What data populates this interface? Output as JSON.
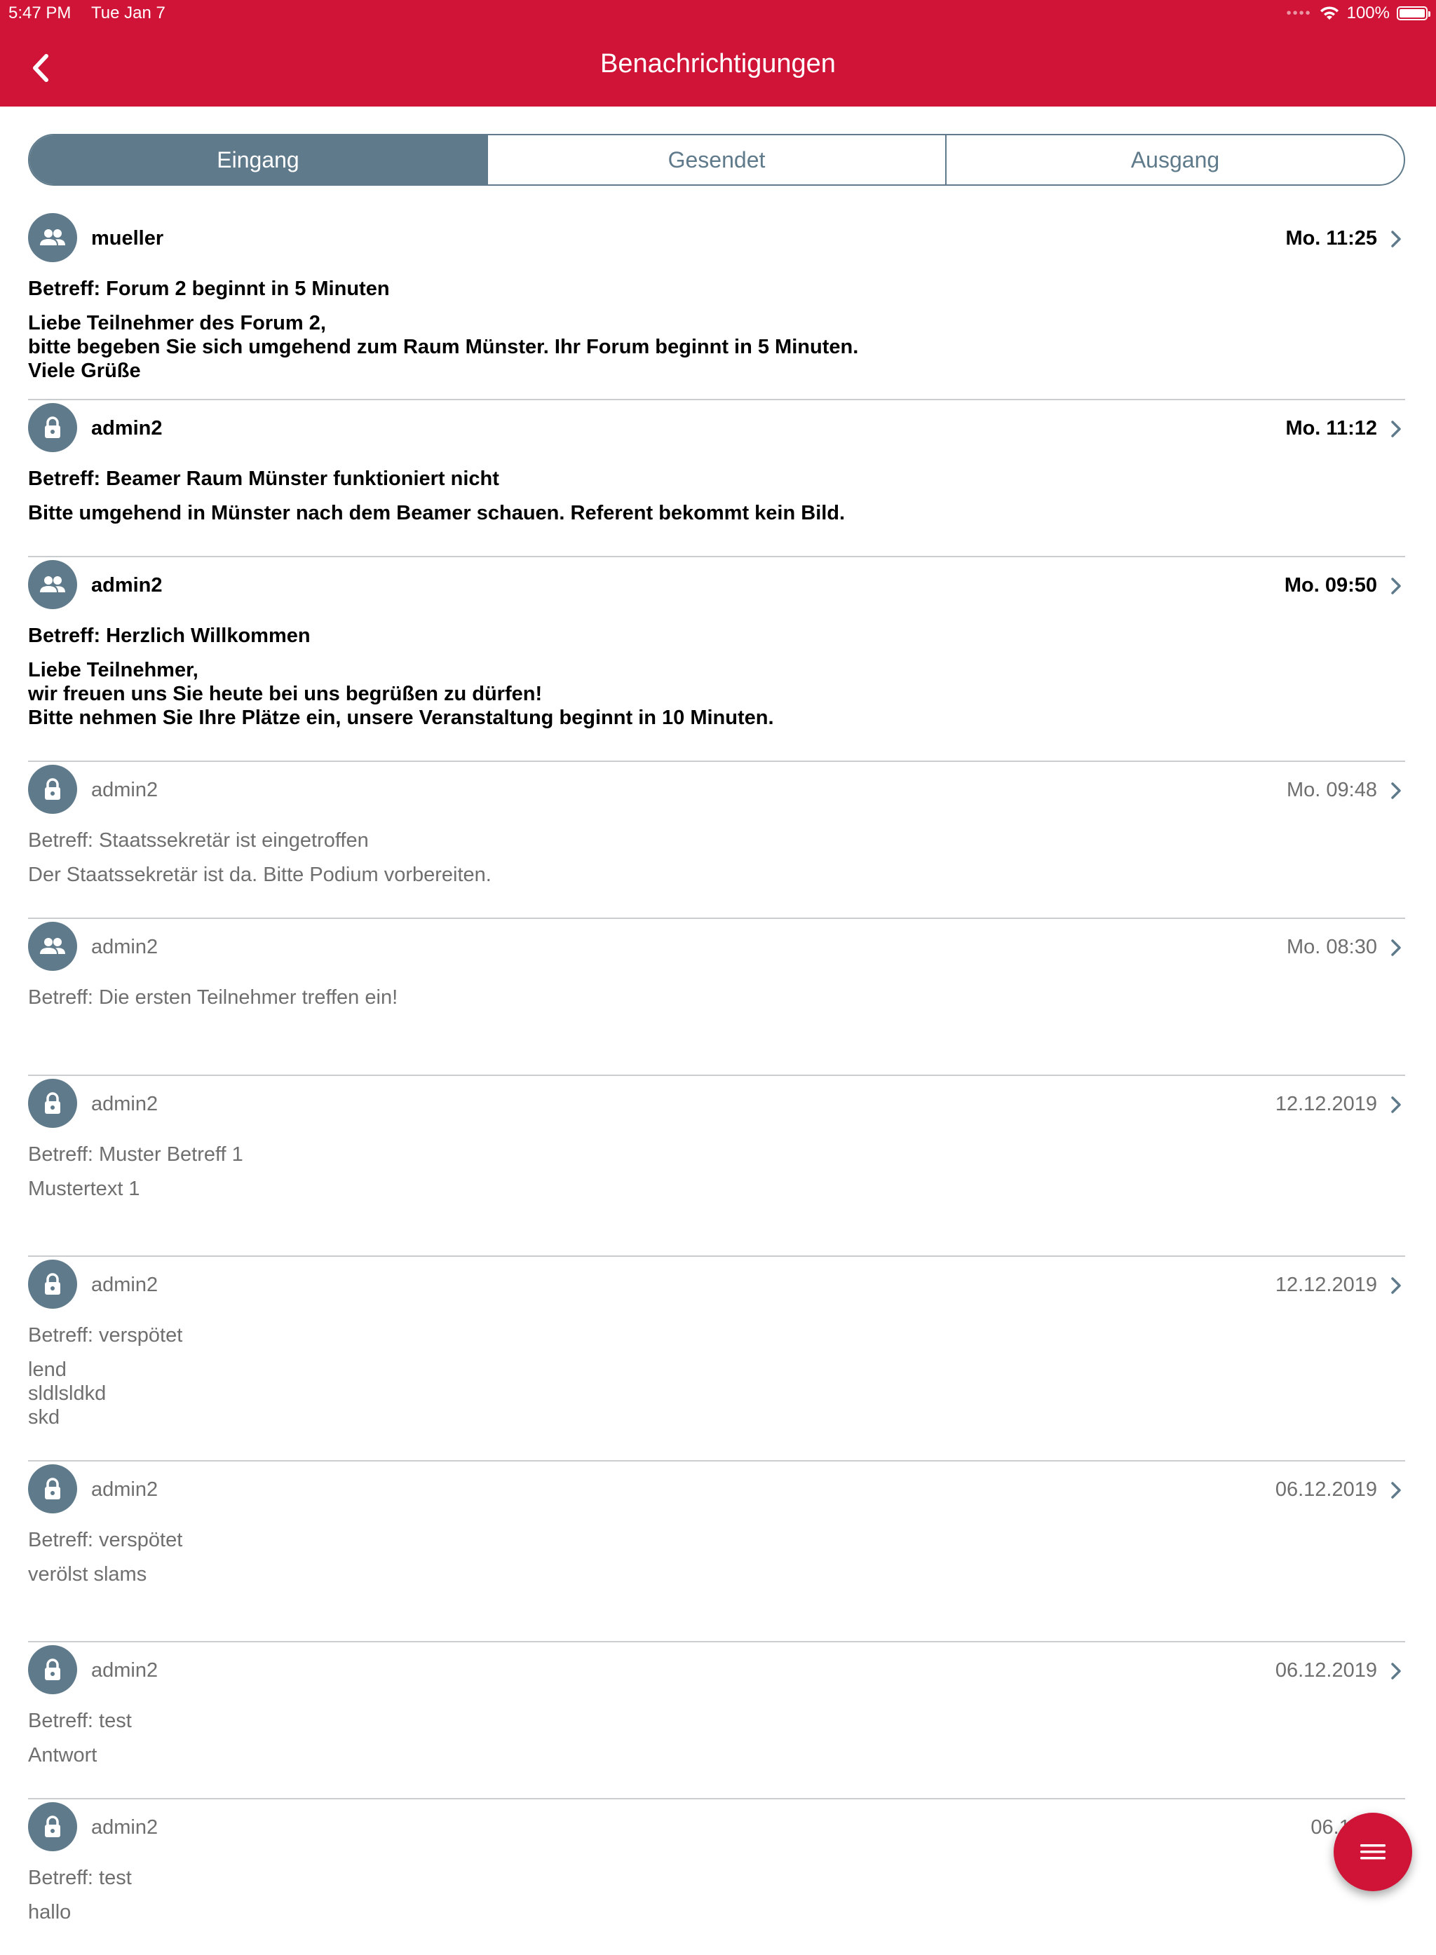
{
  "status_bar": {
    "time": "5:47 PM",
    "date": "Tue Jan 7",
    "battery": "100%"
  },
  "header": {
    "title": "Benachrichtigungen"
  },
  "tabs": [
    {
      "label": "Eingang",
      "active": true
    },
    {
      "label": "Gesendet",
      "active": false
    },
    {
      "label": "Ausgang",
      "active": false
    }
  ],
  "messages": [
    {
      "icon": "group-icon",
      "sender": "mueller",
      "time": "Mo. 11:25",
      "subject": "Betreff: Forum 2 beginnt in 5 Minuten",
      "body": "Liebe Teilnehmer des Forum 2,\nbitte begeben Sie sich umgehend zum Raum Münster. Ihr Forum beginnt in 5 Minuten.\nViele Grüße",
      "unread": true
    },
    {
      "icon": "lock-icon",
      "sender": "admin2",
      "time": "Mo. 11:12",
      "subject": "Betreff: Beamer Raum Münster funktioniert nicht",
      "body": "Bitte umgehend in Münster nach dem Beamer schauen. Referent bekommt kein Bild.",
      "unread": true
    },
    {
      "icon": "group-icon",
      "sender": "admin2",
      "time": "Mo. 09:50",
      "subject": "Betreff: Herzlich Willkommen",
      "body": "Liebe Teilnehmer,\nwir freuen uns Sie heute bei uns begrüßen zu dürfen!\nBitte nehmen Sie Ihre Plätze ein, unsere Veranstaltung beginnt in 10 Minuten.",
      "unread": true
    },
    {
      "icon": "lock-icon",
      "sender": "admin2",
      "time": "Mo. 09:48",
      "subject": "Betreff: Staatssekretär ist eingetroffen",
      "body": "Der Staatssekretär ist da. Bitte Podium vorbereiten.",
      "unread": false
    },
    {
      "icon": "group-icon",
      "sender": "admin2",
      "time": "Mo. 08:30",
      "subject": "Betreff: Die ersten Teilnehmer treffen ein!",
      "body": "",
      "unread": false
    },
    {
      "icon": "lock-icon",
      "sender": "admin2",
      "time": "12.12.2019",
      "subject": "Betreff: Muster Betreff 1",
      "body": "Mustertext 1",
      "unread": false
    },
    {
      "icon": "lock-icon",
      "sender": "admin2",
      "time": "12.12.2019",
      "subject": "Betreff: verspötet",
      "body": "lend\nsldlsldkd\nskd",
      "unread": false
    },
    {
      "icon": "lock-icon",
      "sender": "admin2",
      "time": "06.12.2019",
      "subject": "Betreff: verspötet",
      "body": "verölst slams",
      "unread": false
    },
    {
      "icon": "lock-icon",
      "sender": "admin2",
      "time": "06.12.2019",
      "subject": "Betreff: test",
      "body": "Antwort",
      "unread": false
    },
    {
      "icon": "lock-icon",
      "sender": "admin2",
      "time": "06.11.2",
      "subject": "Betreff: test",
      "body": "hallo",
      "unread": false
    }
  ],
  "colors": {
    "brand_red": "#d01437",
    "slate": "#5f7a8a",
    "divider": "#c9cdd0",
    "read_text": "#6f6f6f"
  },
  "fab": {
    "icon": "menu-icon"
  }
}
